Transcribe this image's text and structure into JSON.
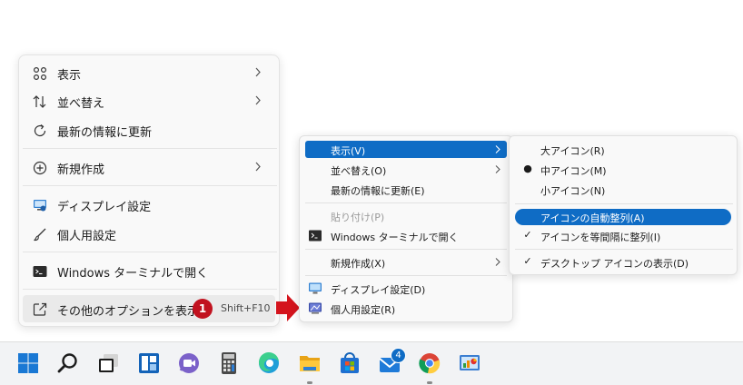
{
  "win11_menu": {
    "items": [
      {
        "label": "表示",
        "icon": "grid-icon",
        "submenu": true
      },
      {
        "label": "並べ替え",
        "icon": "sort-icon",
        "submenu": true
      },
      {
        "label": "最新の情報に更新",
        "icon": "refresh-icon",
        "submenu": false
      },
      {
        "label": "新規作成",
        "icon": "add-circle-icon",
        "submenu": true
      },
      {
        "label": "ディスプレイ設定",
        "icon": "display-settings-icon",
        "submenu": false
      },
      {
        "label": "個人用設定",
        "icon": "brush-icon",
        "submenu": false
      },
      {
        "label": "Windows ターミナルで開く",
        "icon": "terminal-icon",
        "submenu": false
      },
      {
        "label": "その他のオプションを表示",
        "icon": "open-external-icon",
        "submenu": false
      }
    ],
    "shortcut": "Shift+F10",
    "badge": "1"
  },
  "classic_menu": {
    "items": [
      {
        "label": "表示(V)"
      },
      {
        "label": "並べ替え(O)"
      },
      {
        "label": "最新の情報に更新(E)"
      },
      {
        "label": "貼り付け(P)"
      },
      {
        "label": "Windows ターミナルで開く"
      },
      {
        "label": "新規作成(X)"
      },
      {
        "label": "ディスプレイ設定(D)"
      },
      {
        "label": "個人用設定(R)"
      }
    ]
  },
  "view_submenu": {
    "items": [
      {
        "label": "大アイコン(R)",
        "mark": ""
      },
      {
        "label": "中アイコン(M)",
        "mark": "●"
      },
      {
        "label": "小アイコン(N)",
        "mark": ""
      },
      {
        "label": "アイコンの自動整列(A)",
        "mark": ""
      },
      {
        "label": "アイコンを等間隔に整列(I)",
        "mark": "✓"
      },
      {
        "label": "デスクトップ アイコンの表示(D)",
        "mark": "✓"
      }
    ]
  },
  "taskbar": {
    "mail_badge": "4",
    "apps": [
      "start-icon",
      "search-icon",
      "task-view-icon",
      "widgets-icon",
      "chat-icon",
      "calculator-icon",
      "edge-icon",
      "file-explorer-icon",
      "store-icon",
      "mail-icon",
      "chrome-icon",
      "control-panel-icon"
    ]
  },
  "colors": {
    "accent": "#0f6cc5",
    "badge_red": "#c1121f",
    "arrow_red": "#d4141d"
  }
}
